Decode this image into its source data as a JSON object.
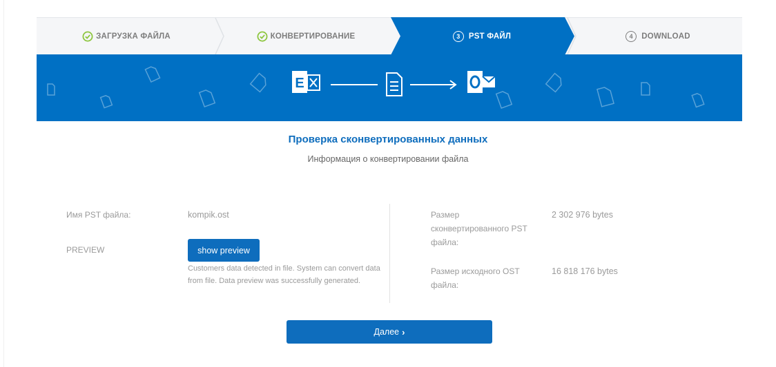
{
  "steps": [
    {
      "label": "ЗАГРУЗКА ФАЙЛА",
      "state": "done",
      "icon": "check-circle-icon"
    },
    {
      "label": "КОНВЕРТИРОВАНИЕ",
      "state": "done",
      "icon": "check-circle-icon"
    },
    {
      "label": "PST ФАЙЛ",
      "state": "active",
      "number": "3"
    },
    {
      "label": "DOWNLOAD",
      "state": "pending",
      "number": "4"
    }
  ],
  "colors": {
    "accent": "#0070c4",
    "button": "#0e6dbd",
    "check": "#8dc63f",
    "step_bg": "#f5f6f8"
  },
  "banner": {
    "icons": [
      "exchange-icon",
      "arrow-line",
      "document-icon",
      "arrow-right",
      "outlook-icon"
    ]
  },
  "heading": "Проверка сконвертированных данных",
  "subheading": "Информация о конвертировании файла",
  "left": {
    "pst_name_label": "Имя PST файла:",
    "pst_name_value": "kompik.ost",
    "preview_label": "PREVIEW",
    "preview_button": "show preview",
    "preview_note": "Customers data detected in file. System can convert data from file. Data preview was successfully generated."
  },
  "right": {
    "converted_size_label": "Размер сконвертированного PST файла:",
    "converted_size_value": "2 302 976 bytes",
    "source_size_label": "Размер исходного OST файла:",
    "source_size_value": "16 818 176 bytes"
  },
  "next_button": "Далее",
  "next_chevron": "›"
}
